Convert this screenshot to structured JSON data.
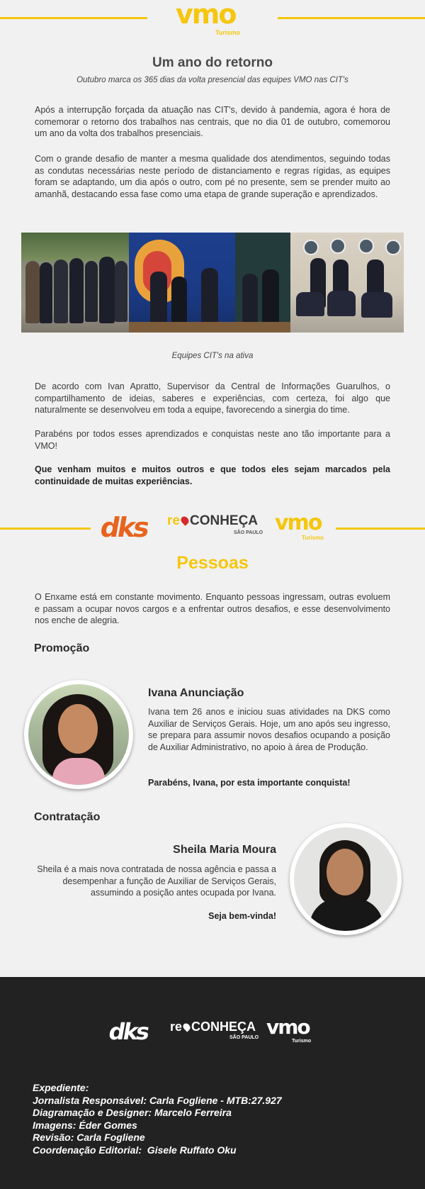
{
  "header": {
    "logo": {
      "name": "VMO",
      "sub": "Turismo"
    },
    "title": "Um ano do retorno",
    "subtitle": "Outubro marca os 365 dias da volta presencial das equipes VMO nas CIT's"
  },
  "article": {
    "p1": "Após a interrupção forçada da atuação nas CIT's, devido à pandemia, agora é hora de comemorar o retorno dos trabalhos nas centrais, que no dia 01 de outubro, comemorou um ano da volta dos trabalhos presenciais.",
    "p2": "Com o grande desafio de manter a mesma qualidade dos atendimentos, seguindo todas as condutas necessárias neste período de distanciamento e regras rígidas, as equipes foram se adaptando, um dia após o outro, com pé no presente, sem se prender muito ao amanhã, destacando essa fase como uma etapa de grande superação e aprendizados.",
    "caption": "Equipes CIT's na ativa",
    "p3": "De acordo com Ivan Apratto, Supervisor da Central de Informações Guarulhos, o compartilhamento de ideias, saberes e experiências, com certeza, foi algo que naturalmente se desenvolveu em toda a equipe, favorecendo a sinergia do time.",
    "p4": "Parabéns por todos esses aprendizados e conquistas neste ano tão importante para a VMO!",
    "p5": "Que venham muitos e muitos outros e que todos eles sejam marcados pela continuidade de muitas experiências."
  },
  "brands": {
    "dks": "DKS",
    "reconheca_pre": "re",
    "reconheca_main": "CONHEÇA",
    "reconheca_sub": "SÃO PAULO",
    "vmo": "VMO",
    "vmo_sub": "Turismo"
  },
  "people": {
    "title": "Pessoas",
    "intro": "O Enxame está em constante movimento. Enquanto pessoas ingressam, outras evoluem e passam a ocupar novos cargos e a enfrentar outros desafios, e esse desenvolvimento nos enche de alegria.",
    "promo_heading": "Promoção",
    "promo_name": "Ivana Anunciação",
    "promo_text": "Ivana tem 26 anos e iniciou suas atividades na DKS como Auxiliar de Serviços Gerais. Hoje, um ano após seu ingresso, se prepara para assumir novos desafios ocupando a posição de Auxiliar Administrativo, no apoio à área de Produção.",
    "promo_congrats": "Parabéns, Ivana, por esta importante conquista!",
    "hire_heading": "Contratação",
    "hire_name": "Sheila Maria Moura",
    "hire_text": "Sheila é a mais nova contratada de nossa agência e passa a desempenhar a função de Auxiliar de Serviços Gerais, assumindo a posição antes ocupada por Ivana.",
    "hire_welcome": "Seja bem-vinda!"
  },
  "footer": {
    "expediente": "Expediente:",
    "journalist": "Jornalista Responsável: Carla Fogliene - MTB:27.927",
    "design": "Diagramação e Designer: Marcelo Ferreira",
    "images": "Imagens: Éder Gomes",
    "review": "Revisão: Carla Fogliene",
    "coordination": "Coordenação Editorial:  Gisele Ruffato Oku"
  },
  "colors": {
    "accent": "#f5c60d",
    "dks_orange": "#e8641e",
    "footer_bg": "#222222"
  }
}
